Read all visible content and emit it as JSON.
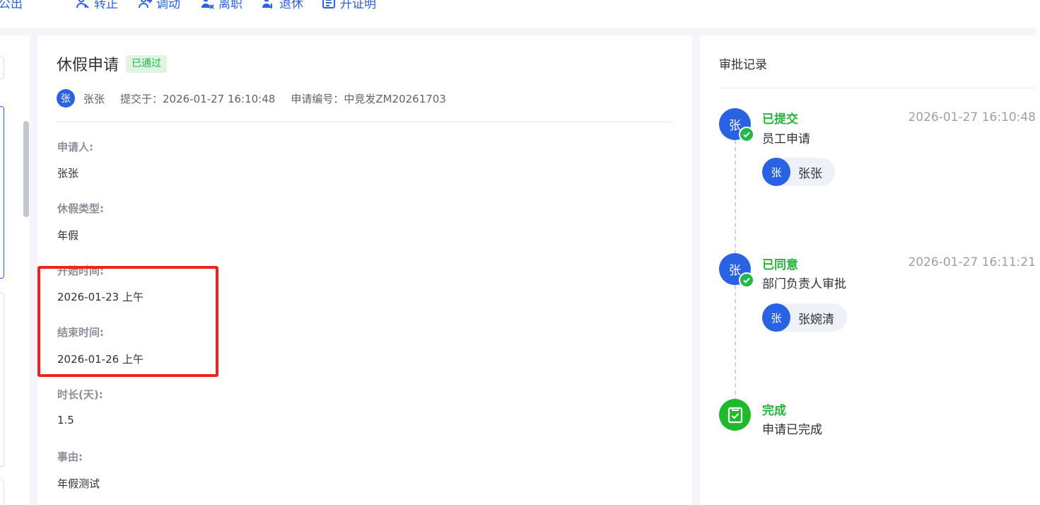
{
  "toolbar": {
    "items": [
      {
        "label": "公出",
        "icon": "outing-icon"
      },
      {
        "label": "转正",
        "icon": "regularize-icon"
      },
      {
        "label": "调动",
        "icon": "transfer-icon"
      },
      {
        "label": "离职",
        "icon": "resign-icon"
      },
      {
        "label": "退休",
        "icon": "retire-icon"
      },
      {
        "label": "开证明",
        "icon": "certificate-icon"
      }
    ]
  },
  "header": {
    "title": "休假申请",
    "status_badge": "已通过",
    "applicant_avatar": "张",
    "applicant_name": "张张",
    "submitted_at": "提交于：2026-01-27 16:10:48",
    "application_no": "申请编号：中竞发ZM20261703"
  },
  "fields": [
    {
      "label": "申请人:",
      "value": "张张"
    },
    {
      "label": "休假类型:",
      "value": "年假"
    },
    {
      "label": "开始时间:",
      "value": "2026-01-23 上午"
    },
    {
      "label": "结束时间:",
      "value": "2026-01-26 上午"
    },
    {
      "label": "时长(天):",
      "value": "1.5"
    },
    {
      "label": "事由:",
      "value": "年假测试"
    }
  ],
  "approval": {
    "title": "审批记录",
    "steps": [
      {
        "avatar": "张",
        "status": "已提交",
        "desc": "员工申请",
        "time": "2026-01-27 16:10:48",
        "person_avatar": "张",
        "person": "张张"
      },
      {
        "avatar": "张",
        "status": "已同意",
        "desc": "部门负责人审批",
        "time": "2026-01-27 16:11:21",
        "person_avatar": "张",
        "person": "张婉清"
      },
      {
        "status": "完成",
        "desc": "申请已完成"
      }
    ]
  },
  "colors": {
    "accent": "#2a62e4",
    "success": "#25b43a",
    "highlight": "#ee2418"
  }
}
